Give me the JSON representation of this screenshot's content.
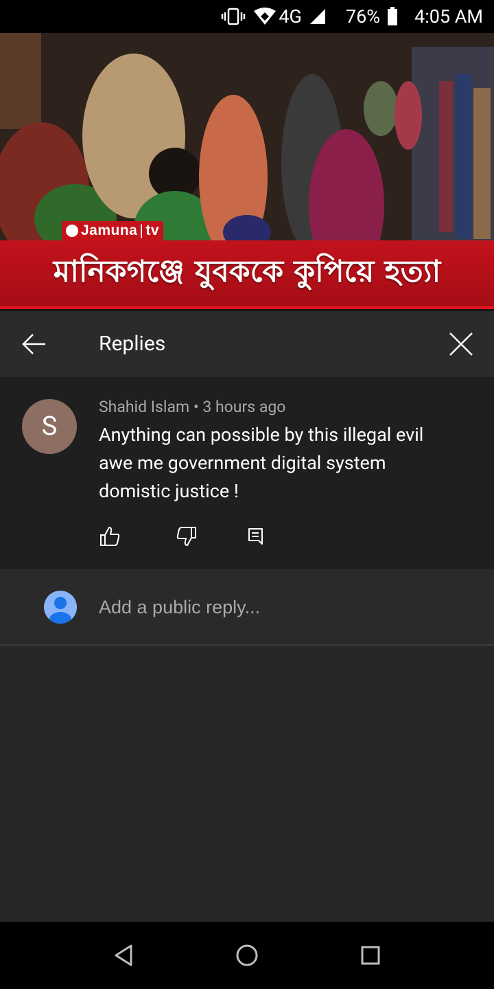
{
  "status_bar": {
    "network": "4G",
    "battery": "76%",
    "time": "4:05 AM",
    "icons": [
      "vibrate-icon",
      "wifi-icon",
      "signal-icon",
      "battery-icon"
    ]
  },
  "video": {
    "channel_logo": {
      "name": "Jamuna",
      "suffix": "tv"
    },
    "headline": "মানিকগঞ্জে যুবককে কুপিয়ে হত্যা",
    "headline_color": "#c3121c"
  },
  "replies_panel": {
    "title": "Replies",
    "back_icon": "arrow-left-icon",
    "close_icon": "close-icon"
  },
  "comment": {
    "avatar_letter": "S",
    "avatar_color": "#8d6e63",
    "author": "Shahid Islam",
    "separator": "•",
    "time": "3 hours ago",
    "text": "Anything can possible by this illegal evil awe me government digital system domistic justice !",
    "actions": [
      "thumbs-up-icon",
      "thumbs-down-icon",
      "reply-icon"
    ]
  },
  "reply_box": {
    "placeholder": "Add a public reply...",
    "value": ""
  },
  "nav_bar": {
    "buttons": [
      "back-triangle-icon",
      "home-circle-icon",
      "recents-square-icon"
    ]
  }
}
